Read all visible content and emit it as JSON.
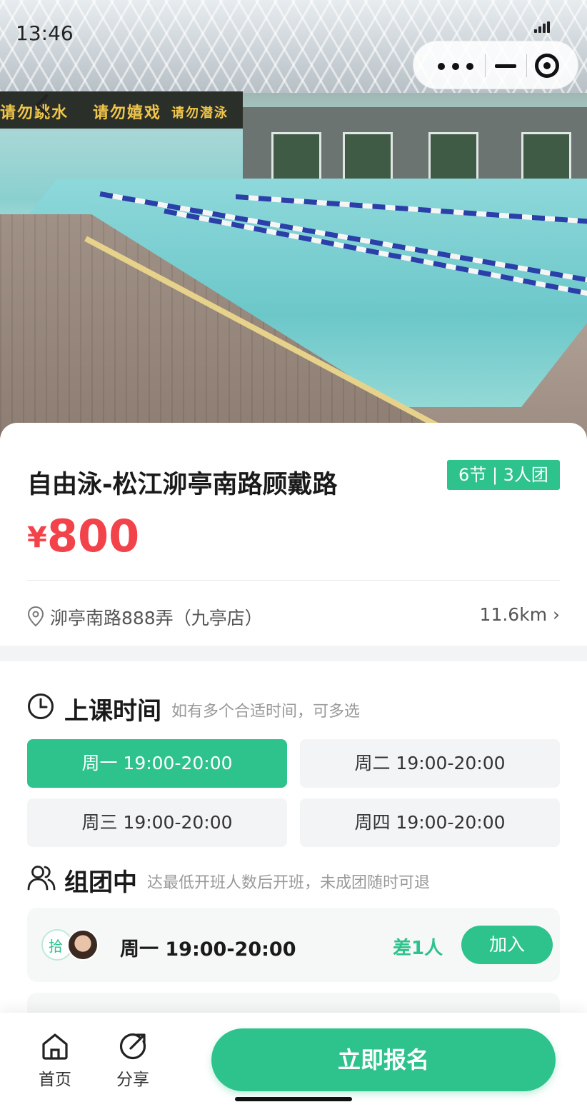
{
  "status_bar": {
    "time": "13:46"
  },
  "hero": {
    "banner_texts": [
      "请勿跳水",
      "请勿嬉戏",
      "请勿潜泳"
    ]
  },
  "course": {
    "title": "自由泳-松江泖亭南路顾戴路",
    "badge": "6节 | 3人团",
    "price_currency": "¥",
    "price_value": "800",
    "address": "泖亭南路888弄（九亭店）",
    "distance": "11.6km ›"
  },
  "schedule": {
    "title": "上课时间",
    "subtitle": "如有多个合适时间，可多选",
    "slots": [
      {
        "label": "周一 19:00-20:00",
        "selected": true
      },
      {
        "label": "周二 19:00-20:00",
        "selected": false
      },
      {
        "label": "周三 19:00-20:00",
        "selected": false
      },
      {
        "label": "周四 19:00-20:00",
        "selected": false
      }
    ]
  },
  "groups": {
    "title": "组团中",
    "subtitle": "达最低开班人数后开班，未成团随时可退",
    "items": [
      {
        "time": "周一 19:00-20:00",
        "need": "差1人",
        "button": "加入",
        "avatar_text": "拾"
      }
    ]
  },
  "bottom_bar": {
    "home_label": "首页",
    "share_label": "分享",
    "signup_label": "立即报名"
  },
  "colors": {
    "accent": "#2ec28c",
    "price": "#f2434a"
  }
}
